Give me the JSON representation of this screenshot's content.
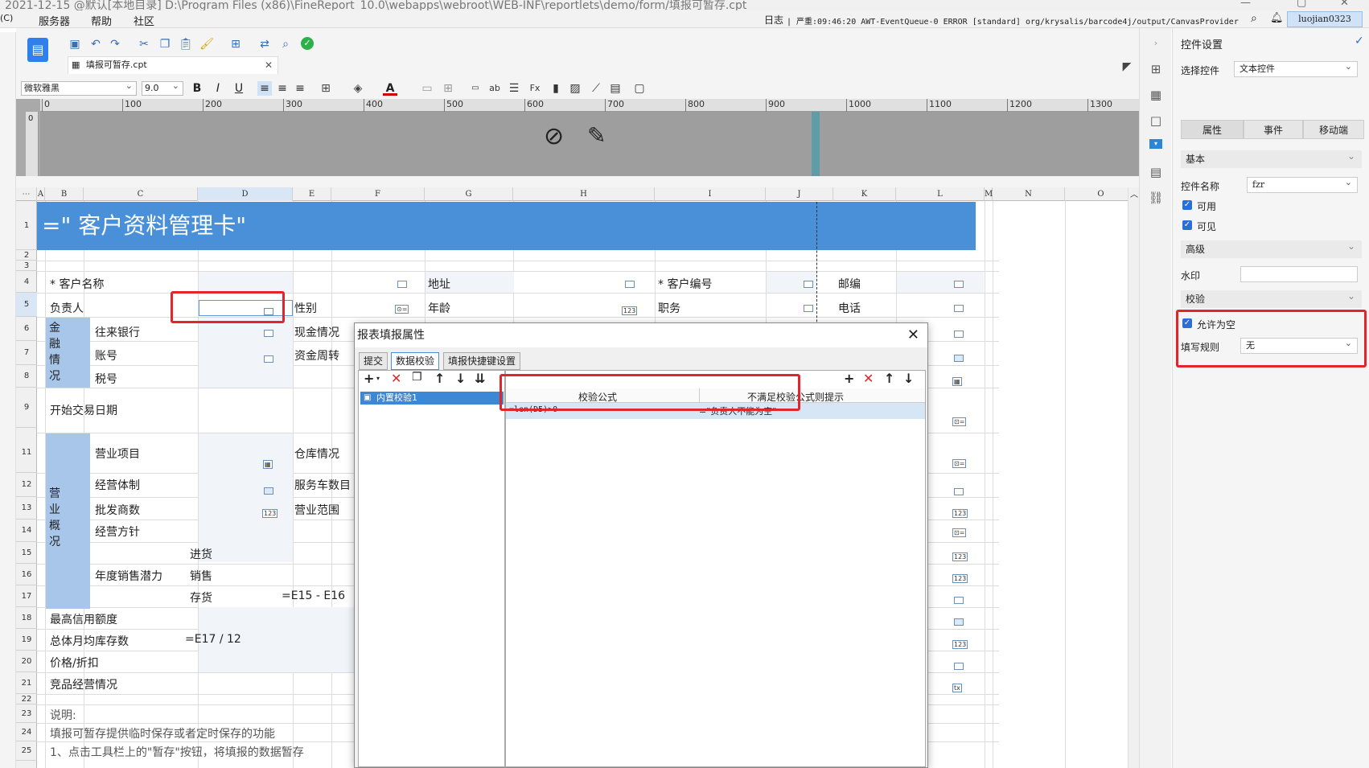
{
  "titlebar": {
    "text": "2021-12-15 @默认[本地目录]    D:\\Program Files (x86)\\FineReport_10.0\\webapps\\webroot\\WEB-INF\\reportlets\\demo/form/填报可暂存.cpt",
    "minimize": "—",
    "maximize": "▢",
    "close": "✕"
  },
  "menubar": {
    "left_stub": "(C)",
    "items": [
      "服务器",
      "帮助",
      "社区"
    ],
    "log_label": "日志",
    "log_text": "| 严重:09:46:20 AWT-EventQueue-0 ERROR [standard] org/krysalis/barcode4j/output/CanvasProvider",
    "user": "luojian0323"
  },
  "toolbar": {
    "file_tab": "填报可暂存.cpt",
    "file_tab_close": "✕",
    "font_name": "微软雅黑",
    "font_size": "9.0"
  },
  "ruler": {
    "ticks": [
      "0",
      "100",
      "200",
      "300",
      "400",
      "500",
      "600",
      "700",
      "800",
      "900",
      "1000",
      "1100",
      "1200",
      "1300"
    ]
  },
  "grid": {
    "columns": [
      "A",
      "B",
      "C",
      "D",
      "E",
      "F",
      "G",
      "H",
      "I",
      "J",
      "K",
      "L",
      "M",
      "N",
      "O"
    ],
    "rows": [
      "1",
      "2",
      "3",
      "4",
      "5",
      "6",
      "7",
      "8",
      "9",
      "11",
      "12",
      "13",
      "14",
      "15",
      "16",
      "17",
      "18",
      "19",
      "20",
      "21",
      "22",
      "23",
      "24",
      "25"
    ],
    "banner": "=\" 客户资料管理卡\"",
    "labels": {
      "customer_name": "* 客户名称",
      "address": "地址",
      "customer_no": "* 客户编号",
      "postcode": "邮编",
      "owner": "负责人",
      "gender": "性别",
      "age": "年龄",
      "position": "职务",
      "phone": "电话",
      "finance_v": "金融情况",
      "bank": "往来银行",
      "cash": "现金情况",
      "account": "账号",
      "turnover": "资金周转",
      "taxno": "税号",
      "start_date": "开始交易日期",
      "business_v": "营业概况",
      "biz_item": "营业项目",
      "warehouse": "仓库情况",
      "biz_system": "经营体制",
      "service_cars": "服务车数目",
      "wholesalers": "批发商数",
      "biz_range": "营业范围",
      "biz_policy": "经营方针",
      "purchase": "进货",
      "annual_potential": "年度销售潜力",
      "sales": "销售",
      "stock": "存货",
      "stock_formula": "=E15 - E16",
      "credit": "最高信用额度",
      "monthly_stock": "总体月均库存数",
      "monthly_formula": "=E17 / 12",
      "price": "价格/折扣",
      "competitor": "竞品经营情况",
      "note": "说明:",
      "note1": "填报可暂存提供临时保存或者定时保存的功能",
      "note2": "1、点击工具栏上的\"暂存\"按钮，将填报的数据暂存"
    }
  },
  "props": {
    "title": "控件设置",
    "select_widget_label": "选择控件",
    "select_widget_value": "文本控件",
    "tabs": [
      "属性",
      "事件",
      "移动端"
    ],
    "basic": "基本",
    "widget_name_label": "控件名称",
    "widget_name_value": "fzr",
    "enabled": "可用",
    "visible": "可见",
    "advanced": "高级",
    "watermark": "水印",
    "validate": "校验",
    "allow_empty": "允许为空",
    "rule_label": "填写规则",
    "rule_value": "无"
  },
  "dialog": {
    "title": "报表填报属性",
    "close": "✕",
    "tabs": [
      "提交",
      "数据校验",
      "填报快捷键设置"
    ],
    "list_item": "内置校验1",
    "col_formula": "校验公式",
    "col_message": "不满足校验公式则提示",
    "row_formula": "=len(D5)>0",
    "row_message": "=\"负责人不能为空\""
  },
  "colors": {
    "banner": "#4a90d9",
    "group_cell": "#a7c6ea",
    "highlight": "#e0262b",
    "accent": "#2b6fd6"
  }
}
